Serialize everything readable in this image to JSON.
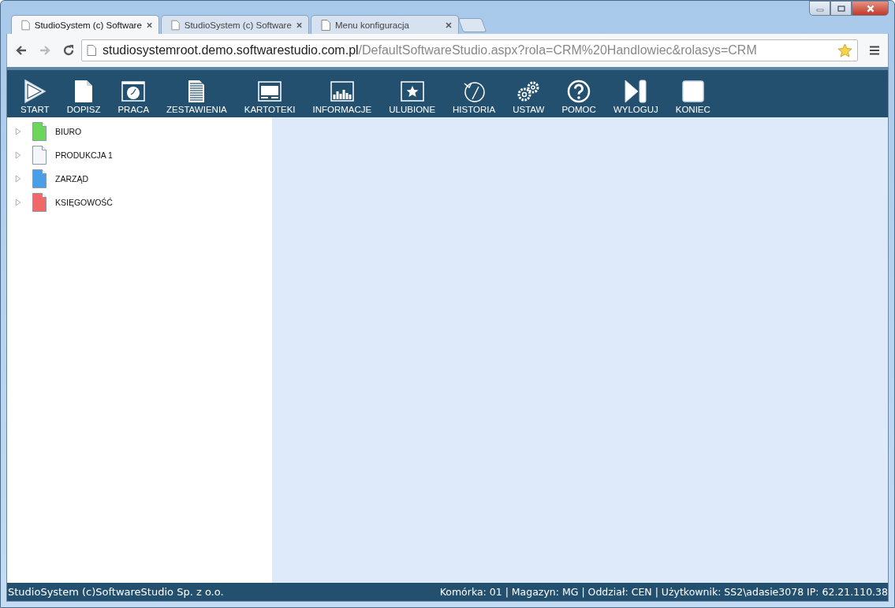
{
  "browser": {
    "tabs": [
      {
        "label": "StudioSystem (c) Software",
        "selected": true
      },
      {
        "label": "StudioSystem (c) Software",
        "selected": false
      },
      {
        "label": "Menu konfiguracja",
        "selected": false
      }
    ],
    "address": {
      "host": "studiosystemroot.demo.softwarestudio.com.pl",
      "path": "/DefaultSoftwareStudio.aspx?rola=CRM%20Handlowiec&rolasys=CRM"
    }
  },
  "toolbar": [
    {
      "kind": "play",
      "label": "START"
    },
    {
      "kind": "page",
      "label": "DOPISZ"
    },
    {
      "kind": "clock",
      "label": "PRACA"
    },
    {
      "kind": "report",
      "label": "ZESTAWIENIA"
    },
    {
      "kind": "window",
      "label": "KARTOTEKI"
    },
    {
      "kind": "chart",
      "label": "INFORMACJE"
    },
    {
      "kind": "star",
      "label": "ULUBIONE"
    },
    {
      "kind": "history",
      "label": "HISTORIA"
    },
    {
      "kind": "gears",
      "label": "USTAW"
    },
    {
      "kind": "help",
      "label": "POMOC"
    },
    {
      "kind": "skip",
      "label": "WYLOGUJ"
    },
    {
      "kind": "stop",
      "label": "KONIEC"
    }
  ],
  "tree": [
    {
      "label": "BIURO",
      "color": "#6cd65a",
      "expanded": false
    },
    {
      "label": "PRODUKCJA 1",
      "color": "#f4f6fa",
      "expanded": false
    },
    {
      "label": "ZARZĄD",
      "color": "#4a9ee8",
      "expanded": false
    },
    {
      "label": "KSIĘGOWOŚĆ",
      "color": "#f06868",
      "expanded": false
    }
  ],
  "status_bar": {
    "left": "StudioSystem (c)SoftwareStudio Sp. z o.o.",
    "right": "Komórka: 01 | Magazyn: MG | Oddział: CEN | Użytkownik: SS2\\adasie3078 IP: 62.21.110.38"
  }
}
